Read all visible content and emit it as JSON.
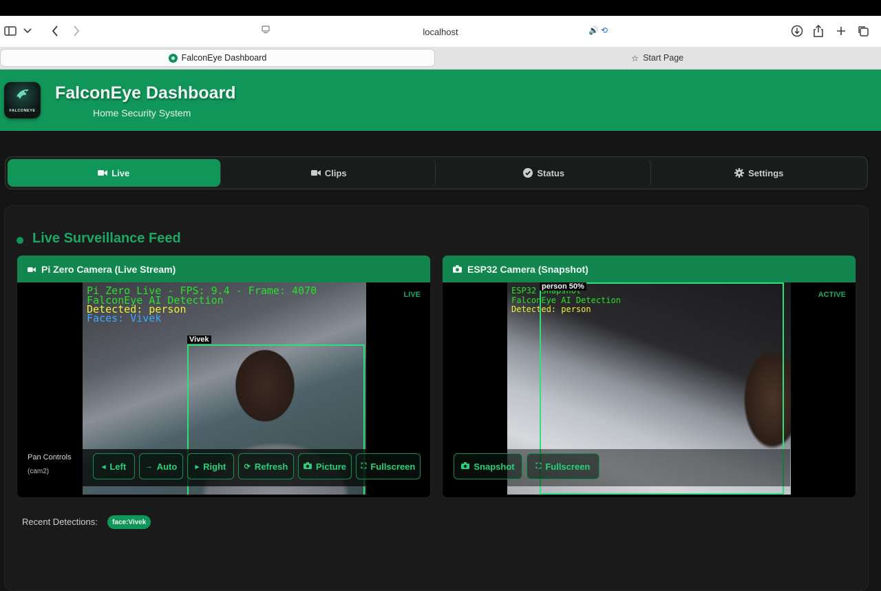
{
  "browser": {
    "url": "localhost",
    "tabs": [
      {
        "label": "FalconEye Dashboard",
        "active": true
      },
      {
        "label": "Start Page",
        "active": false
      }
    ]
  },
  "header": {
    "logo_text": "FALCONEYE",
    "title": "FalconEye Dashboard",
    "subtitle": "Home Security System",
    "brand_color": "#11965a"
  },
  "nav": {
    "tabs": [
      {
        "label": "Live",
        "icon": "video-icon",
        "active": true
      },
      {
        "label": "Clips",
        "icon": "video-icon",
        "active": false
      },
      {
        "label": "Status",
        "icon": "check-circle-icon",
        "active": false
      },
      {
        "label": "Settings",
        "icon": "gear-icon",
        "active": false
      }
    ]
  },
  "section": {
    "title": "Live Surveillance Feed"
  },
  "cameras": [
    {
      "title": "Pi Zero Camera (Live Stream)",
      "icon": "video-icon",
      "badge": "LIVE",
      "overlay": {
        "line1": "Pi Zero Live - FPS: 9.4 - Frame: 4070",
        "line2": "FalconEye AI Detection",
        "line3": "Detected: person",
        "line4": "Faces: Vivek",
        "box_label": "Vivek"
      },
      "controls": {
        "pan_label": "Pan Controls",
        "pan_sub": "(cam2)",
        "buttons": [
          {
            "label": "Left",
            "icon": "caret-left-icon"
          },
          {
            "label": "Auto",
            "icon": "arrow-right-icon"
          },
          {
            "label": "Right",
            "icon": "caret-right-icon"
          },
          {
            "label": "Refresh",
            "icon": "refresh-icon"
          },
          {
            "label": "Picture",
            "icon": "camera-icon"
          },
          {
            "label": "Fullscreen",
            "icon": "expand-icon"
          }
        ]
      }
    },
    {
      "title": "ESP32 Camera (Snapshot)",
      "icon": "camera-icon",
      "badge": "ACTIVE",
      "overlay": {
        "line1": "ESP32 Snapshot",
        "line2": "FalconEye AI Detection",
        "line3": "Detected: person",
        "box_label": "person 50%"
      },
      "controls": {
        "buttons": [
          {
            "label": "Snapshot",
            "icon": "camera-icon"
          },
          {
            "label": "Fullscreen",
            "icon": "expand-icon"
          }
        ]
      }
    }
  ],
  "recent": {
    "label": "Recent Detections:",
    "chips": [
      "face:Vivek"
    ]
  }
}
